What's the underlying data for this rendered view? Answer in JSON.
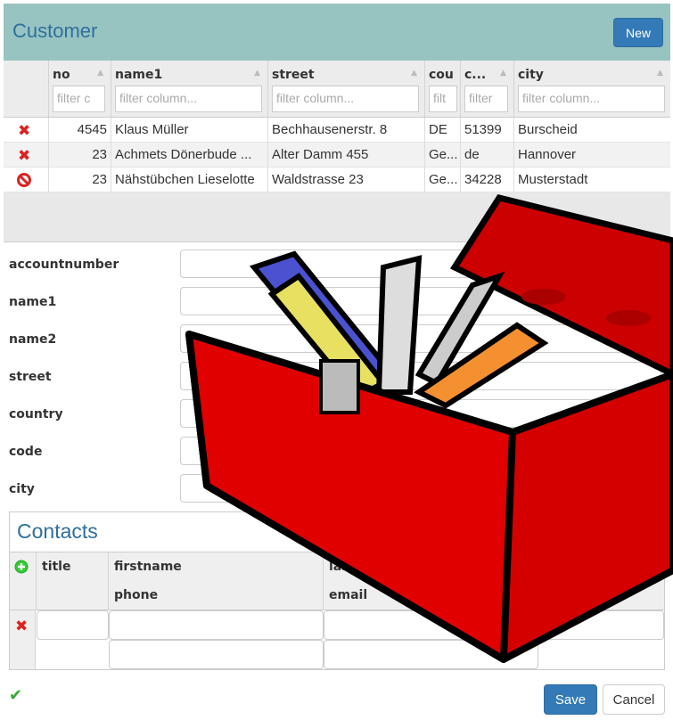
{
  "header": {
    "title": "Customer",
    "new_label": "New"
  },
  "grid": {
    "columns": [
      {
        "label": "no",
        "filter": "filter c"
      },
      {
        "label": "name1",
        "filter": "filter column..."
      },
      {
        "label": "street",
        "filter": "filter column..."
      },
      {
        "label": "cou",
        "filter": "filt"
      },
      {
        "label": "c...",
        "filter": "filter"
      },
      {
        "label": "city",
        "filter": "filter column..."
      }
    ],
    "rows": [
      {
        "icon": "delete-icon",
        "no": "4545",
        "name1": "Klaus Müller",
        "street": "Bechhausenerstr. 8",
        "country": "DE",
        "code": "51399",
        "city": "Burscheid"
      },
      {
        "icon": "delete-icon",
        "no": "23",
        "name1": "Achmets Dönerbude ...",
        "street": "Alter Damm 455",
        "country": "Ge...",
        "code": "de",
        "city": "Hannover"
      },
      {
        "icon": "forbidden-icon",
        "no": "23",
        "name1": "Nähstübchen Lieselotte",
        "street": "Waldstrasse 23",
        "country": "Ge...",
        "code": "34228",
        "city": "Musterstadt"
      }
    ]
  },
  "form": {
    "fields": [
      {
        "label": "accountnumber",
        "value": ""
      },
      {
        "label": "name1",
        "value": ""
      },
      {
        "label": "name2",
        "value": ""
      },
      {
        "label": "street",
        "value": ""
      },
      {
        "label": "country",
        "value": ""
      },
      {
        "label": "code",
        "value": ""
      },
      {
        "label": "city",
        "value": ""
      }
    ]
  },
  "contacts": {
    "title": "Contacts",
    "headers": {
      "title": "title",
      "firstname": "firstname",
      "lastname": "lastna",
      "phone": "phone",
      "email": "email"
    }
  },
  "footer": {
    "save_label": "Save",
    "cancel_label": "Cancel"
  },
  "colors": {
    "header_bg": "#97c4c1",
    "accent": "#337ab7",
    "title": "#2e6f9e",
    "delete": "#d22222",
    "toolbox_red": "#d40000"
  }
}
